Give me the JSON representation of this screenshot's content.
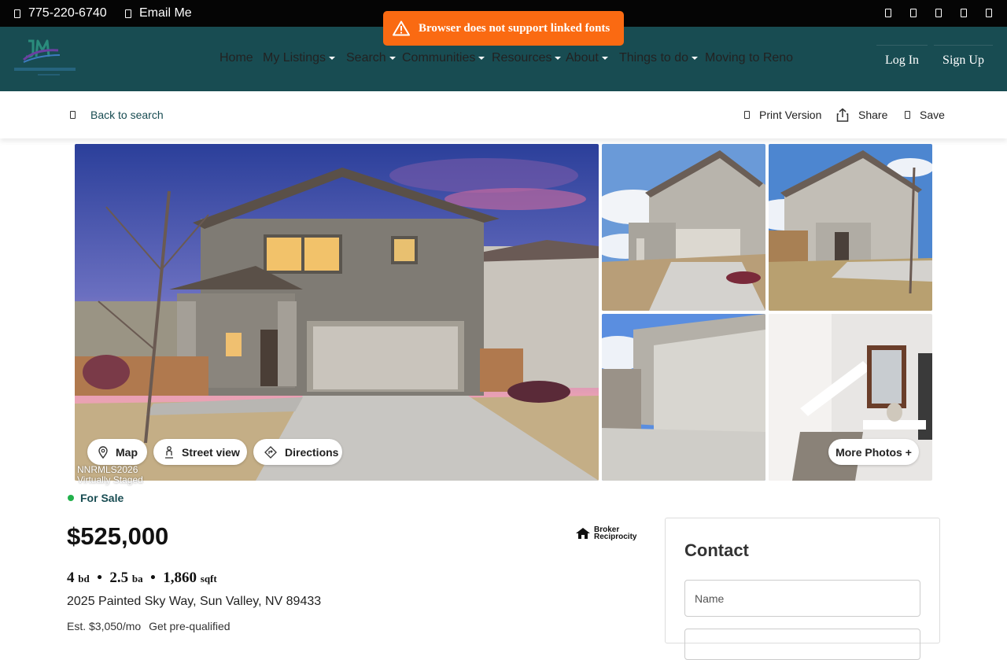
{
  "topbar": {
    "phone": "775-220-6740",
    "email": "Email Me",
    "social_icons": [
      "social-icon-1",
      "social-icon-2",
      "social-icon-3",
      "social-icon-4",
      "social-icon-5"
    ]
  },
  "toast": {
    "message": "Browser does not support linked fonts",
    "icon": "warning-icon",
    "color": "#fa6a12"
  },
  "nav": {
    "background": "#184c52",
    "items": [
      {
        "label": "Home",
        "dropdown": false
      },
      {
        "label": "My Listings",
        "dropdown": true
      },
      {
        "label": "Search",
        "dropdown": true
      },
      {
        "label": "Communities",
        "dropdown": true
      },
      {
        "label": "Resources",
        "dropdown": true
      },
      {
        "label": "About",
        "dropdown": true
      },
      {
        "label": "Things to do",
        "dropdown": true
      },
      {
        "label": "Moving to Reno",
        "dropdown": false
      }
    ],
    "login": "Log In",
    "signup": "Sign Up"
  },
  "actions": {
    "back": "Back to search",
    "print": "Print Version",
    "share": "Share",
    "save": "Save"
  },
  "photos": {
    "map": "Map",
    "street_view": "Street view",
    "directions": "Directions",
    "more_photos": "More Photos +",
    "watermark_line1": "NNRMLS2026",
    "watermark_line2": "Virtually Staged"
  },
  "listing": {
    "status": "For Sale",
    "status_color": "#22b14c",
    "price": "$525,000",
    "beds": "4",
    "beds_unit": "bd",
    "baths": "2.5",
    "baths_unit": "ba",
    "sqft": "1,860",
    "sqft_unit": "sqft",
    "address": "2025 Painted Sky Way, Sun Valley, NV 89433",
    "estimate": "Est. $3,050/mo",
    "prequalify": "Get pre-qualified",
    "broker_line1": "Broker",
    "broker_line2": "Reciprocity"
  },
  "contact": {
    "title": "Contact",
    "name_placeholder": "Name"
  }
}
